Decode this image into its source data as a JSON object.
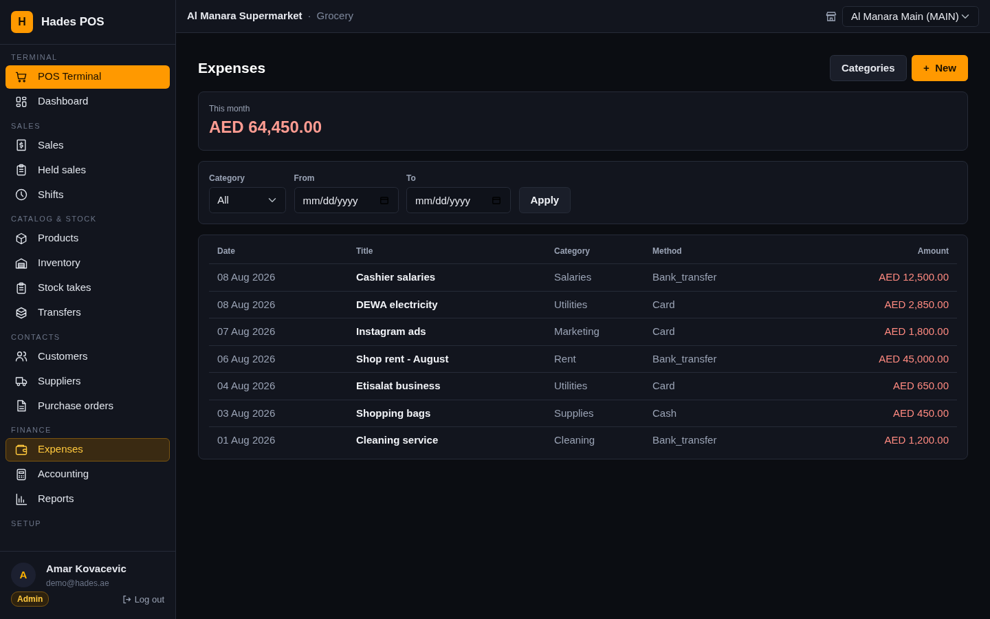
{
  "brand": {
    "logo_letter": "H",
    "name": "Hades POS"
  },
  "sidebar": {
    "sections": [
      {
        "heading": "TERMINAL",
        "items": [
          {
            "label": "POS Terminal",
            "kind": "cta",
            "selected": false
          },
          {
            "label": "Dashboard",
            "kind": "link",
            "selected": false
          }
        ]
      },
      {
        "heading": "SALES",
        "items": [
          {
            "label": "Sales",
            "kind": "link",
            "selected": false
          },
          {
            "label": "Held sales",
            "kind": "link",
            "selected": false
          },
          {
            "label": "Shifts",
            "kind": "link",
            "selected": false
          }
        ]
      },
      {
        "heading": "CATALOG & STOCK",
        "items": [
          {
            "label": "Products",
            "kind": "link",
            "selected": false
          },
          {
            "label": "Inventory",
            "kind": "link",
            "selected": false
          },
          {
            "label": "Stock takes",
            "kind": "link",
            "selected": false
          },
          {
            "label": "Transfers",
            "kind": "link",
            "selected": false
          }
        ]
      },
      {
        "heading": "CONTACTS",
        "items": [
          {
            "label": "Customers",
            "kind": "link",
            "selected": false
          },
          {
            "label": "Suppliers",
            "kind": "link",
            "selected": false
          },
          {
            "label": "Purchase orders",
            "kind": "link",
            "selected": false
          }
        ]
      },
      {
        "heading": "FINANCE",
        "items": [
          {
            "label": "Expenses",
            "kind": "link",
            "selected": true
          },
          {
            "label": "Accounting",
            "kind": "link",
            "selected": false
          },
          {
            "label": "Reports",
            "kind": "link",
            "selected": false
          }
        ]
      },
      {
        "heading": "SETUP"
      }
    ]
  },
  "user": {
    "initial": "A",
    "name": "Amar Kovacevic",
    "email": "demo@hades.ae",
    "role": "Admin",
    "logout": "Log out"
  },
  "topbar": {
    "store": "Al Manara Supermarket",
    "separator": "·",
    "type": "Grocery",
    "branch": "Al Manara Main (MAIN)"
  },
  "page": {
    "title": "Expenses",
    "buttons": [
      {
        "label": "Categories",
        "kind": "secondary"
      },
      {
        "label": "New",
        "kind": "primary",
        "icon": "+"
      }
    ]
  },
  "summary": {
    "label": "This month",
    "value": "AED 64,450.00"
  },
  "filters": {
    "category": {
      "label": "Category",
      "value": "All"
    },
    "from": {
      "label": "From",
      "placeholder": "mm/dd/yyyy"
    },
    "to": {
      "label": "To",
      "placeholder": "mm/dd/yyyy"
    },
    "apply": "Apply"
  },
  "table": {
    "columns": [
      "Date",
      "Title",
      "Category",
      "Method",
      "Amount"
    ],
    "rows": [
      [
        "08 Aug 2026",
        "Cashier salaries",
        "Salaries",
        "Bank_transfer",
        "AED 12,500.00"
      ],
      [
        "08 Aug 2026",
        "DEWA electricity",
        "Utilities",
        "Card",
        "AED 2,850.00"
      ],
      [
        "07 Aug 2026",
        "Instagram ads",
        "Marketing",
        "Card",
        "AED 1,800.00"
      ],
      [
        "06 Aug 2026",
        "Shop rent - August",
        "Rent",
        "Bank_transfer",
        "AED 45,000.00"
      ],
      [
        "04 Aug 2026",
        "Etisalat business",
        "Utilities",
        "Card",
        "AED 650.00"
      ],
      [
        "03 Aug 2026",
        "Shopping bags",
        "Supplies",
        "Cash",
        "AED 450.00"
      ],
      [
        "01 Aug 2026",
        "Cleaning service",
        "Cleaning",
        "Bank_transfer",
        "AED 1,200.00"
      ]
    ]
  }
}
